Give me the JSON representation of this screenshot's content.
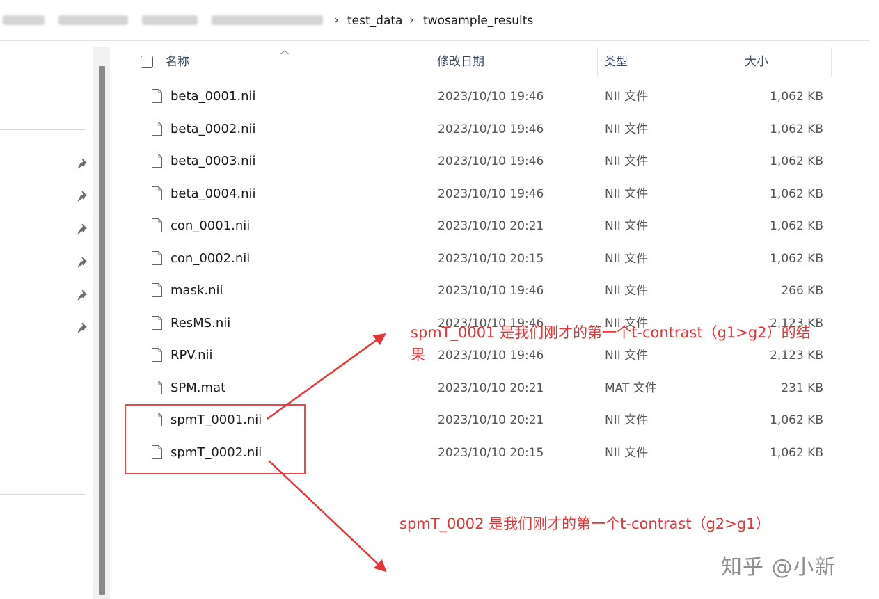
{
  "breadcrumb": {
    "items": [
      "test_data",
      "twosample_results"
    ],
    "separator": "›"
  },
  "columns": {
    "name": "名称",
    "modified": "修改日期",
    "type": "类型",
    "size": "大小"
  },
  "files": [
    {
      "name": "beta_0001.nii",
      "modified": "2023/10/10 19:46",
      "type": "NII 文件",
      "size": "1,062 KB"
    },
    {
      "name": "beta_0002.nii",
      "modified": "2023/10/10 19:46",
      "type": "NII 文件",
      "size": "1,062 KB"
    },
    {
      "name": "beta_0003.nii",
      "modified": "2023/10/10 19:46",
      "type": "NII 文件",
      "size": "1,062 KB"
    },
    {
      "name": "beta_0004.nii",
      "modified": "2023/10/10 19:46",
      "type": "NII 文件",
      "size": "1,062 KB"
    },
    {
      "name": "con_0001.nii",
      "modified": "2023/10/10 20:21",
      "type": "NII 文件",
      "size": "1,062 KB"
    },
    {
      "name": "con_0002.nii",
      "modified": "2023/10/10 20:15",
      "type": "NII 文件",
      "size": "1,062 KB"
    },
    {
      "name": "mask.nii",
      "modified": "2023/10/10 19:46",
      "type": "NII 文件",
      "size": "266 KB"
    },
    {
      "name": "ResMS.nii",
      "modified": "2023/10/10 19:46",
      "type": "NII 文件",
      "size": "2,123 KB"
    },
    {
      "name": "RPV.nii",
      "modified": "2023/10/10 19:46",
      "type": "NII 文件",
      "size": "2,123 KB"
    },
    {
      "name": "SPM.mat",
      "modified": "2023/10/10 20:21",
      "type": "MAT 文件",
      "size": "231 KB"
    },
    {
      "name": "spmT_0001.nii",
      "modified": "2023/10/10 20:21",
      "type": "NII 文件",
      "size": "1,062 KB"
    },
    {
      "name": "spmT_0002.nii",
      "modified": "2023/10/10 20:15",
      "type": "NII 文件",
      "size": "1,062 KB"
    }
  ],
  "annotations": {
    "note1_line1": "spmT_0001 是我们刚才的第一个t-contrast（g1>g2）的结",
    "note1_line2": "果",
    "note2": "spmT_0002 是我们刚才的第一个t-contrast（g2>g1）",
    "color": "#e83434"
  },
  "watermark": "知乎 @小新",
  "icons": {
    "pin": "pin-icon",
    "file": "file-icon",
    "sort": "sort-up-icon"
  }
}
